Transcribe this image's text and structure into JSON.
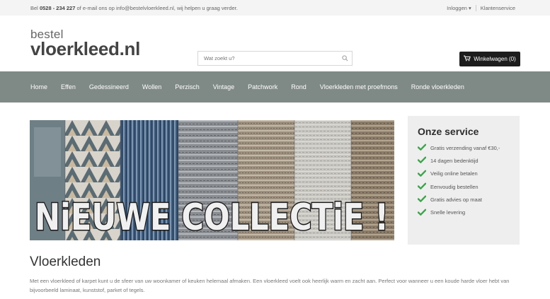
{
  "topbar": {
    "phone_prefix": "Bel",
    "phone": "0528 - 234 227",
    "phone_suffix": "of e-mail ons op info@bestelvloerkleed.nl, wij helpen u graag verder.",
    "login": "Inloggen",
    "customer_service": "Klantenservice"
  },
  "logo": {
    "top": "bestel",
    "bottom": "vloerkleed.nl"
  },
  "search": {
    "placeholder": "Wat zoekt u?"
  },
  "cart": {
    "label": "Winkelwagen (0)"
  },
  "nav": {
    "items": [
      "Home",
      "Effen",
      "Gedessineerd",
      "Wollen",
      "Perzisch",
      "Vintage",
      "Patchwork",
      "Rond",
      "Vloerkleden met proefmons",
      "Ronde vloerkleden"
    ]
  },
  "banner": {
    "text": "NiEUWE COLLECTiE !"
  },
  "service": {
    "title": "Onze service",
    "items": [
      "Gratis verzending vanaf €30,-",
      "14 dagen bedenktijd",
      "Veilig online betalen",
      "Eenvoudig bestellen",
      "Gratis advies op maat",
      "Snelle levering"
    ]
  },
  "content": {
    "title": "Vloerkleden",
    "text": "Met een vloerkleed of karpet kunt u de sfeer van uw woonkamer of keuken helemaal afmaken. Een vloerkleed voelt ook heerlijk warm en zacht aan. Perfect voor wanneer u een koude harde vloer hebt van bijvoorbeeld laminaat, kunststof, parket of tegels."
  },
  "colors": {
    "nav_bg": "#7f8a86",
    "check_green": "#3fa34d",
    "cart_bg": "#1d1d1d"
  }
}
